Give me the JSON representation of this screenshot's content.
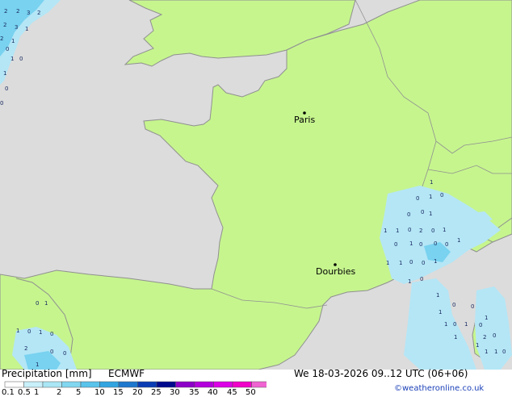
{
  "map": {
    "cities": [
      {
        "name": "Paris"
      },
      {
        "name": "Dourbies"
      }
    ],
    "precip_labels": [
      "2",
      "2",
      "3",
      "2",
      "2",
      "3",
      "1",
      "2",
      "1",
      "0",
      "1",
      "0",
      "1",
      "0",
      "0",
      "1",
      "0",
      "1",
      "0",
      "0",
      "0",
      "1",
      "1",
      "0",
      "2",
      "0",
      "1",
      "1",
      "0",
      "1",
      "0",
      "0",
      "0",
      "1",
      "1",
      "1",
      "0",
      "0",
      "1",
      "1",
      "0",
      "1",
      "0",
      "0",
      "1",
      "1",
      "0",
      "1",
      "0",
      "1",
      "1",
      "2",
      "1",
      "0",
      "1",
      "1",
      "0",
      "0",
      "1",
      "1",
      "0",
      "1",
      "0",
      "2",
      "0",
      "1",
      "0"
    ],
    "colors": {
      "land": "#c6f58e",
      "sea": "#dcdcdc",
      "border": "#909090",
      "coast": "#909090",
      "precip_light": "#b4e6f6",
      "precip_mid": "#78d2f0"
    }
  },
  "legend": {
    "title": "Precipitation [mm]",
    "model": "ECMWF",
    "tick_labels": [
      "0.1",
      "0.5",
      "1",
      "2",
      "5",
      "10",
      "15",
      "20",
      "25",
      "30",
      "35",
      "40",
      "45",
      "50"
    ],
    "colors": [
      "#ffffff",
      "#c8f0fa",
      "#aae6f5",
      "#82d7f0",
      "#5ac3eb",
      "#32a5e1",
      "#1e78cd",
      "#0a3cb4",
      "#000a8c",
      "#8c00c8",
      "#b400dc",
      "#dc00e6",
      "#f000c8",
      "#f064d2"
    ]
  },
  "footer": {
    "datetime": "We 18-03-2026 09..12 UTC (06+06)",
    "credit": "©weatheronline.co.uk"
  }
}
